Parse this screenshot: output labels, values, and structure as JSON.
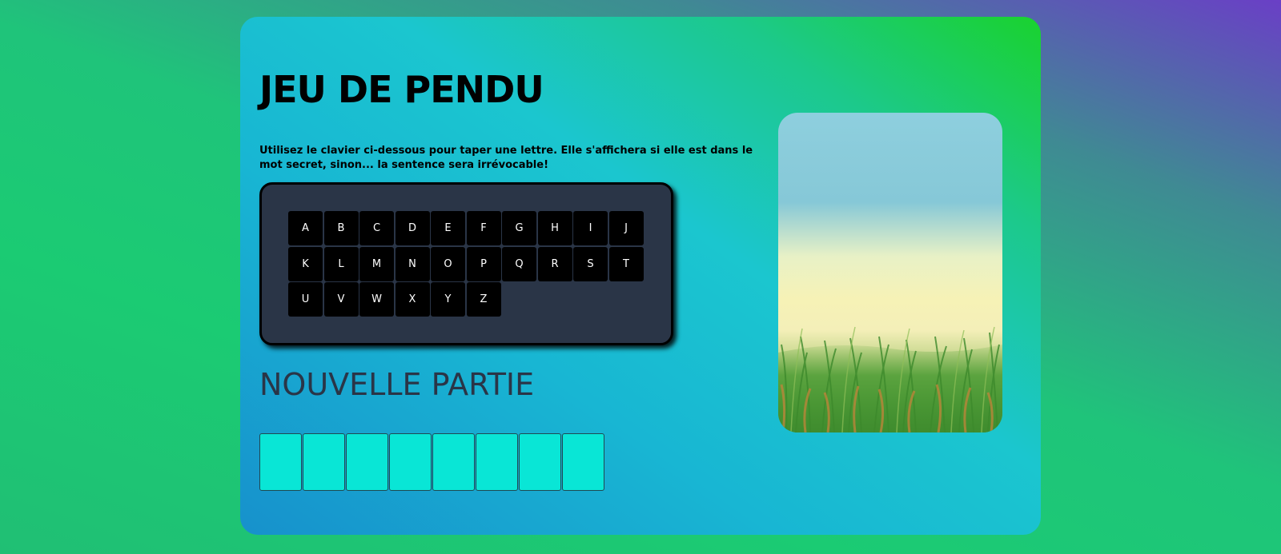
{
  "game": {
    "title": "JEU DE PENDU",
    "instructions": "Utilisez le clavier ci-dessous pour taper une lettre. Elle s'affichera si elle est dans le mot secret, sinon... la sentence sera irrévocable!",
    "new_game_label": "NOUVELLE PARTIE"
  },
  "keyboard": {
    "keys": [
      "A",
      "B",
      "C",
      "D",
      "E",
      "F",
      "G",
      "H",
      "I",
      "J",
      "K",
      "L",
      "M",
      "N",
      "O",
      "P",
      "Q",
      "R",
      "S",
      "T",
      "U",
      "V",
      "W",
      "X",
      "Y",
      "Z"
    ]
  },
  "word": {
    "slots": [
      "",
      "",
      "",
      "",
      "",
      "",
      "",
      ""
    ]
  },
  "scene": {
    "image": "grass-meadow-scene"
  },
  "colors": {
    "keyboard_bg": "#2a3547",
    "key_bg": "#000000",
    "slot_bg": "#09e6d6",
    "new_game_text": "#2a3547"
  }
}
